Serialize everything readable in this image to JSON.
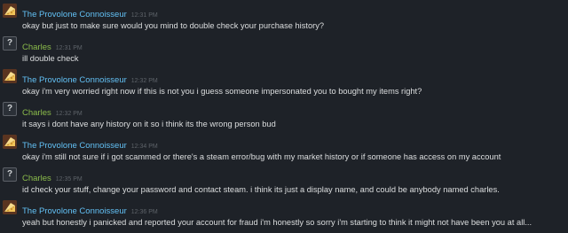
{
  "colors": {
    "background": "#1e2228",
    "sender_a": "#62c0f4",
    "sender_b": "#8bbc4b",
    "message_text": "#dcdedf",
    "timestamp": "#5e6369"
  },
  "messages": [
    {
      "sender": "The Provolone Connoisseur",
      "timestamp": "12:31 PM",
      "avatar": "cheese-avatar-icon",
      "text": "okay but just to make sure would you mind to double check your purchase history?"
    },
    {
      "sender": "Charles",
      "timestamp": "12:31 PM",
      "avatar": "unknown-avatar-icon",
      "avatar_glyph": "?",
      "text": "ill double check"
    },
    {
      "sender": "The Provolone Connoisseur",
      "timestamp": "12:32 PM",
      "avatar": "cheese-avatar-icon",
      "text": "okay i'm very worried right now if this is not you i guess someone impersonated you to bought my items right?"
    },
    {
      "sender": "Charles",
      "timestamp": "12:32 PM",
      "avatar": "unknown-avatar-icon",
      "avatar_glyph": "?",
      "text": "it says i dont have any history on it so i think its the wrong person bud"
    },
    {
      "sender": "The Provolone Connoisseur",
      "timestamp": "12:34 PM",
      "avatar": "cheese-avatar-icon",
      "text": "okay i'm still not sure if i got scammed or there's a steam error/bug with my market history or if someone has access on my account"
    },
    {
      "sender": "Charles",
      "timestamp": "12:35 PM",
      "avatar": "unknown-avatar-icon",
      "avatar_glyph": "?",
      "text": "id check your stuff, change your password and contact steam. i think its just a display name, and could be anybody named charles."
    },
    {
      "sender": "The Provolone Connoisseur",
      "timestamp": "12:36 PM",
      "avatar": "cheese-avatar-icon",
      "text": "yeah but honestly i panicked and reported your account for fraud i'm honestly so sorry i'm starting to think it might not have been you at all..."
    }
  ]
}
